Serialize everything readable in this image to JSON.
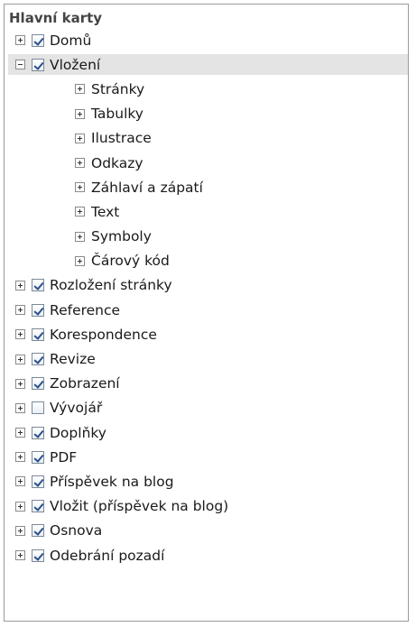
{
  "header": {
    "title": "Hlavní karty"
  },
  "tree": {
    "items": [
      {
        "label": "Domů",
        "checked": true,
        "expanded": false
      },
      {
        "label": "Vložení",
        "checked": true,
        "expanded": true,
        "selected": true,
        "children": [
          "Stránky",
          "Tabulky",
          "Ilustrace",
          "Odkazy",
          "Záhlaví a zápatí",
          "Text",
          "Symboly",
          "Čárový kód"
        ]
      },
      {
        "label": "Rozložení stránky",
        "checked": true,
        "expanded": false
      },
      {
        "label": "Reference",
        "checked": true,
        "expanded": false
      },
      {
        "label": "Korespondence",
        "checked": true,
        "expanded": false
      },
      {
        "label": "Revize",
        "checked": true,
        "expanded": false
      },
      {
        "label": "Zobrazení",
        "checked": true,
        "expanded": false
      },
      {
        "label": "Vývojář",
        "checked": false,
        "expanded": false
      },
      {
        "label": "Doplňky",
        "checked": true,
        "expanded": false
      },
      {
        "label": "PDF",
        "checked": true,
        "expanded": false
      },
      {
        "label": "Příspěvek na blog",
        "checked": true,
        "expanded": false
      },
      {
        "label": "Vložit (příspěvek na blog)",
        "checked": true,
        "expanded": false
      },
      {
        "label": "Osnova",
        "checked": true,
        "expanded": false
      },
      {
        "label": "Odebrání pozadí",
        "checked": true,
        "expanded": false
      }
    ]
  },
  "colors": {
    "selection": "#e4e4e4",
    "check": "#2a4f8a",
    "border": "#9a9a9a"
  }
}
